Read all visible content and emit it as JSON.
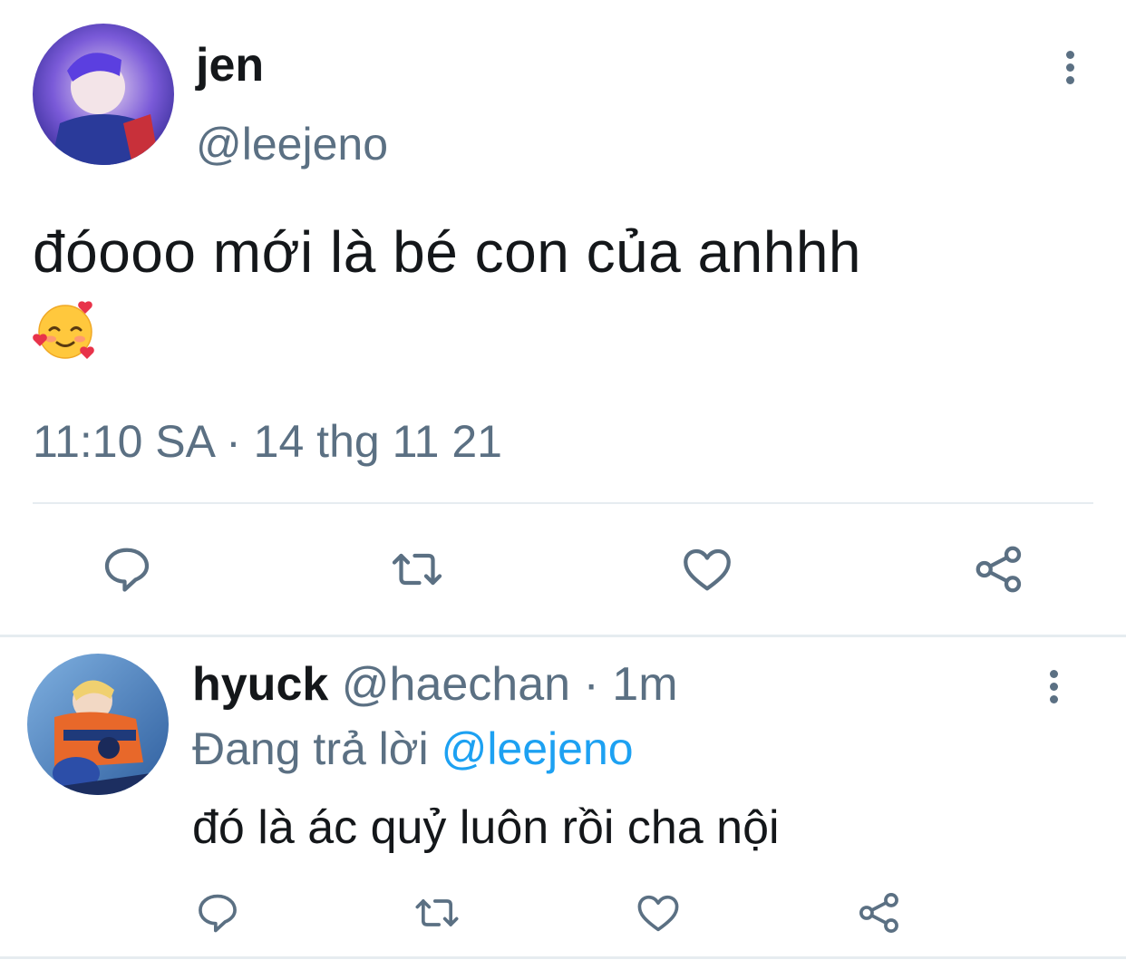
{
  "main_tweet": {
    "author_name": "jen",
    "author_handle": "@leejeno",
    "text": "đóooo mới là bé con của anhhh",
    "emoji": "smiling-face-with-hearts",
    "timestamp": "11:10 SA · 14 thg 11 21",
    "actions": [
      "reply-icon",
      "retweet-icon",
      "like-icon",
      "share-icon"
    ]
  },
  "reply_tweet": {
    "author_name": "hyuck",
    "author_handle": "@haechan",
    "time": "1m",
    "separator": " · ",
    "replying_prefix": "Đang trả lời ",
    "replying_to": "@leejeno",
    "text": "đó là ác quỷ luôn rồi cha nội",
    "actions": [
      "reply-icon",
      "retweet-icon",
      "like-icon",
      "share-icon"
    ]
  },
  "colors": {
    "text": "#14171a",
    "secondary": "#5b7083",
    "link": "#1da1f2",
    "divider": "#e6ecf0"
  }
}
